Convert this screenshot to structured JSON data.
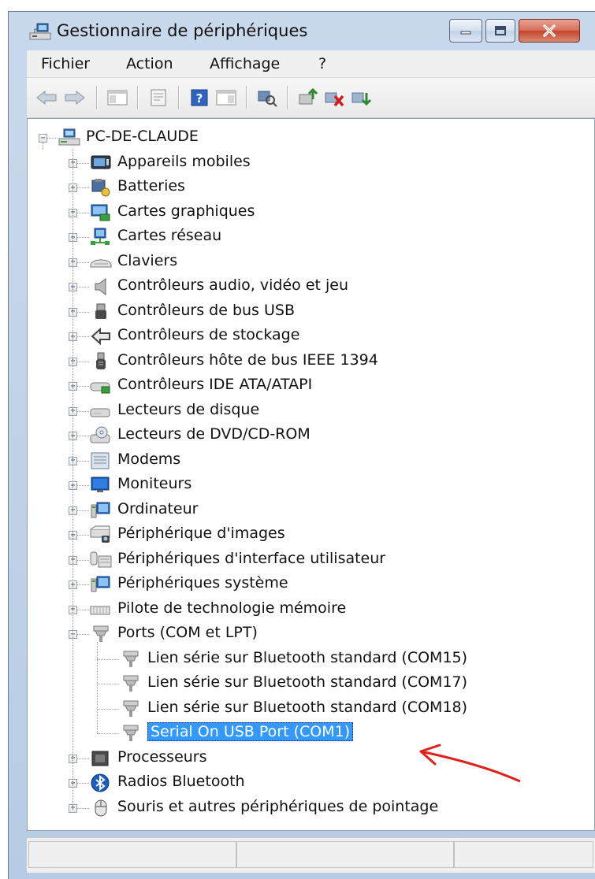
{
  "window": {
    "title": "Gestionnaire de périphériques",
    "close_icon": "close-icon",
    "minimize_icon": "minimize-icon",
    "maximize_icon": "maximize-icon"
  },
  "menu": [
    "Fichier",
    "Action",
    "Affichage",
    "?"
  ],
  "toolbar": {
    "icons": [
      "back-icon",
      "forward-icon",
      "show-hide-console-tree-icon",
      "properties-icon",
      "help-icon",
      "show-action-pane-icon",
      "scan-hardware-icon",
      "update-driver-icon",
      "disable-device-icon",
      "uninstall-device-icon"
    ]
  },
  "tree": {
    "root": "PC-DE-CLAUDE",
    "categories": [
      {
        "label": "Appareils mobiles",
        "icon": "mobile-devices-icon"
      },
      {
        "label": "Batteries",
        "icon": "battery-icon"
      },
      {
        "label": "Cartes graphiques",
        "icon": "display-adapter-icon"
      },
      {
        "label": "Cartes réseau",
        "icon": "network-adapter-icon"
      },
      {
        "label": "Claviers",
        "icon": "keyboard-icon"
      },
      {
        "label": "Contrôleurs audio, vidéo et jeu",
        "icon": "speaker-icon"
      },
      {
        "label": "Contrôleurs de bus USB",
        "icon": "usb-icon"
      },
      {
        "label": "Contrôleurs de stockage",
        "icon": "storage-controller-icon"
      },
      {
        "label": "Contrôleurs hôte de bus IEEE 1394",
        "icon": "ieee1394-icon"
      },
      {
        "label": "Contrôleurs IDE ATA/ATAPI",
        "icon": "ide-controller-icon"
      },
      {
        "label": "Lecteurs de disque",
        "icon": "disk-drive-icon"
      },
      {
        "label": "Lecteurs de DVD/CD-ROM",
        "icon": "dvd-drive-icon"
      },
      {
        "label": "Modems",
        "icon": "modem-icon"
      },
      {
        "label": "Moniteurs",
        "icon": "monitor-icon"
      },
      {
        "label": "Ordinateur",
        "icon": "computer-icon"
      },
      {
        "label": "Périphérique d'images",
        "icon": "imaging-device-icon"
      },
      {
        "label": "Périphériques d'interface utilisateur",
        "icon": "hid-icon"
      },
      {
        "label": "Périphériques système",
        "icon": "system-devices-icon"
      },
      {
        "label": "Pilote de technologie mémoire",
        "icon": "memory-technology-icon"
      },
      {
        "label": "Ports (COM et LPT)",
        "icon": "port-icon",
        "expanded": true,
        "children": [
          {
            "label": "Lien série sur Bluetooth standard (COM15)",
            "icon": "port-icon"
          },
          {
            "label": "Lien série sur Bluetooth standard (COM17)",
            "icon": "port-icon"
          },
          {
            "label": "Lien série sur Bluetooth standard (COM18)",
            "icon": "port-icon"
          },
          {
            "label": "Serial On USB Port (COM1)",
            "icon": "port-icon",
            "selected": true
          }
        ]
      },
      {
        "label": "Processeurs",
        "icon": "processor-icon"
      },
      {
        "label": "Radios Bluetooth",
        "icon": "bluetooth-icon"
      },
      {
        "label": "Souris et autres périphériques de pointage",
        "icon": "mouse-icon"
      }
    ]
  },
  "colors": {
    "selection": "#3399ff",
    "annotation_arrow": "#e0201b"
  }
}
